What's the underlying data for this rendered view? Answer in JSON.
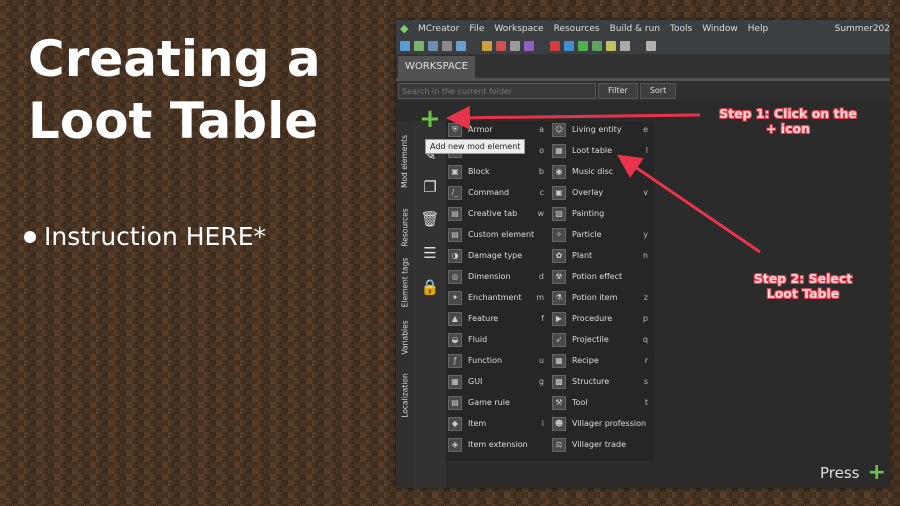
{
  "slide": {
    "title_line1": "Creating a",
    "title_line2": "Loot Table",
    "bullet": "Instruction HERE*"
  },
  "app": {
    "name": "MCreator",
    "menu": [
      "File",
      "Workspace",
      "Resources",
      "Build & run",
      "Tools",
      "Window",
      "Help"
    ],
    "workspace_name": "Summer202",
    "tab": "WORKSPACE",
    "search_placeholder": "Search in the current folder",
    "filter_label": "Filter",
    "sort_label": "Sort",
    "vertical_tabs": [
      "Mod elements",
      "Resources",
      "Element tags",
      "Variables",
      "Localization"
    ],
    "tooltip": "Add new mod element",
    "press_label": "Press",
    "elements_left": [
      {
        "label": "Armor",
        "key": "a"
      },
      {
        "label": "Biome",
        "key": "o"
      },
      {
        "label": "Block",
        "key": "b"
      },
      {
        "label": "Command",
        "key": "c"
      },
      {
        "label": "Creative tab",
        "key": "w"
      },
      {
        "label": "Custom element",
        "key": ""
      },
      {
        "label": "Damage type",
        "key": ""
      },
      {
        "label": "Dimension",
        "key": "d"
      },
      {
        "label": "Enchantment",
        "key": "m"
      },
      {
        "label": "Feature",
        "key": "f"
      },
      {
        "label": "Fluid",
        "key": ""
      },
      {
        "label": "Function",
        "key": "u"
      },
      {
        "label": "GUI",
        "key": "g"
      },
      {
        "label": "Game rule",
        "key": ""
      },
      {
        "label": "Item",
        "key": "i"
      },
      {
        "label": "Item extension",
        "key": ""
      }
    ],
    "elements_right": [
      {
        "label": "Living entity",
        "key": "e"
      },
      {
        "label": "Loot table",
        "key": "l"
      },
      {
        "label": "Music disc",
        "key": ""
      },
      {
        "label": "Overlay",
        "key": "v"
      },
      {
        "label": "Painting",
        "key": ""
      },
      {
        "label": "Particle",
        "key": "y"
      },
      {
        "label": "Plant",
        "key": "n"
      },
      {
        "label": "Potion effect",
        "key": ""
      },
      {
        "label": "Potion item",
        "key": "z"
      },
      {
        "label": "Procedure",
        "key": "p"
      },
      {
        "label": "Projectile",
        "key": "q"
      },
      {
        "label": "Recipe",
        "key": "r"
      },
      {
        "label": "Structure",
        "key": "s"
      },
      {
        "label": "Tool",
        "key": "t"
      },
      {
        "label": "Villager profession",
        "key": ""
      },
      {
        "label": "Villager trade",
        "key": ""
      }
    ]
  },
  "annotations": {
    "step1_line1": "Step 1:  Click on the",
    "step1_line2": "+ icon",
    "step2_line1": "Step 2: Select",
    "step2_line2": "Loot Table",
    "color": "#e8344a"
  }
}
